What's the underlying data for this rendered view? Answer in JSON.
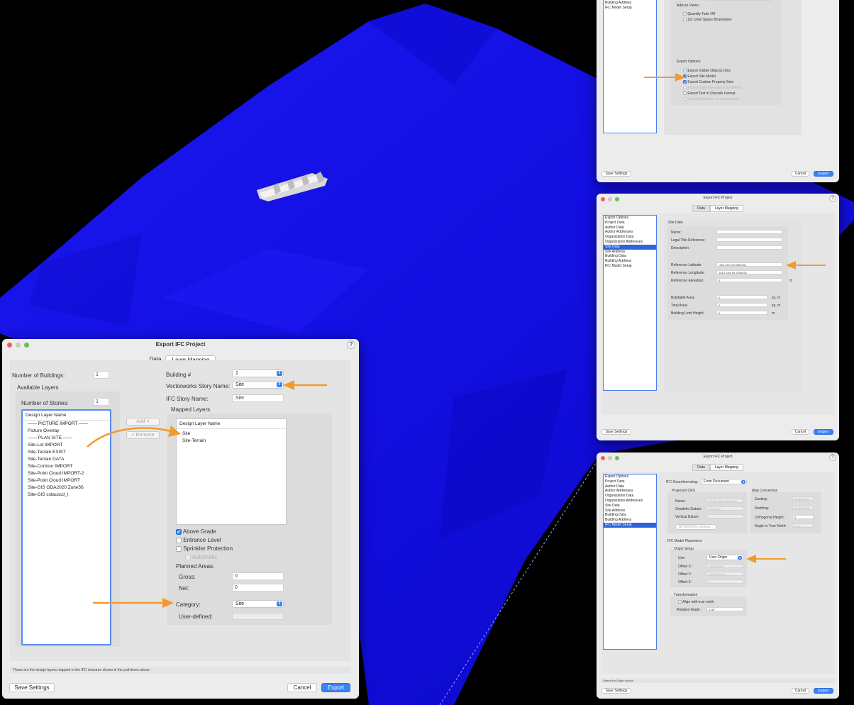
{
  "colors": {
    "terrain": "#1410e8",
    "accent": "#3a82f7",
    "arrow": "#f29a2e",
    "selection": "#2f64d9"
  },
  "main": {
    "title": "Export IFC Project",
    "tabs": [
      "Data",
      "Layer Mapping"
    ],
    "num_buildings_label": "Number of Buildings:",
    "num_buildings": "1",
    "available_layers_label": "Available Layers",
    "num_stories_label": "Number of Stories:",
    "num_stories": "1",
    "available_header": "Design Layer Name",
    "available": [
      "—— PICTURE IMPORT ——",
      "Picture Overlay",
      "—— PLAN SITE ——",
      "Site-Lot IMPORT",
      "Site-Terrain EXIST",
      "Site-Terrain DATA",
      "Site-Contour IMPORT",
      "Site-Point Cloud IMPORT-2",
      "Site-Point Cloud IMPORT",
      "Site-GIS GDA2020 Zone56",
      "Site-GIS cstauscd_l"
    ],
    "add_button": "Add >",
    "remove_button": "< Remove",
    "building_label": "Building #",
    "building_value": "1",
    "vw_story_label": "Vectorworks Story Name:",
    "vw_story_value": "Site",
    "ifc_story_label": "IFC Story Name:",
    "ifc_story_value": "Site",
    "mapped_label": "Mapped Layers",
    "mapped_header": "Design Layer Name",
    "mapped": [
      "Site",
      "Site-Terrain"
    ],
    "above_grade": "Above Grade",
    "entrance_level": "Entrance Level",
    "sprinkler": "Sprinkler Protection",
    "automatic": "Automatic",
    "planned_areas": "Planned Areas:",
    "gross_label": "Gross:",
    "gross_value": "0",
    "net_label": "Net:",
    "net_value": "0",
    "category_label": "Category:",
    "category_value": "Site",
    "user_defined_label": "User-defined:",
    "status": "These are the design layers mapped to the IFC structure shown in the pull-down above.",
    "save_settings": "Save Settings",
    "cancel": "Cancel",
    "export": "Export"
  },
  "top": {
    "sidebar": [
      "Building Address",
      "IFC Model Setup"
    ],
    "addon_label": "Add-on Views:",
    "addon": [
      "Quantity Take Off",
      "1st Level Space Boundaries"
    ],
    "options_label": "Export Options:",
    "options": [
      {
        "label": "Export Visible Objects Only",
        "checked": false,
        "enabled": true
      },
      {
        "label": "Export Site Model",
        "checked": true,
        "enabled": true
      },
      {
        "label": "Export Custom Property Sets",
        "checked": true,
        "enabled": true
      },
      {
        "label": "Export Solid Operations as BREPs",
        "checked": false,
        "enabled": false
      },
      {
        "label": "Export Text in Unicode Format",
        "checked": false,
        "enabled": true
      },
      {
        "label": "Export Metaltitles to components",
        "checked": false,
        "enabled": false
      }
    ],
    "save_settings": "Save Settings",
    "cancel": "Cancel",
    "export": "Export"
  },
  "mid": {
    "title": "Export IFC Project",
    "tabs": [
      "Data",
      "Layer Mapping"
    ],
    "sidebar": [
      "Export Options",
      "Project Data",
      "Author Data",
      "Author Addresses",
      "Organization Data",
      "Organization Addresses",
      "Site Data",
      "Site Address",
      "Building Data",
      "Building Address",
      "IFC Model Setup"
    ],
    "selected": "Site Data",
    "heading": "Site Data",
    "name": "Name:",
    "legal": "Legal Title Reference:",
    "description": "Description:",
    "ref_lat": "Reference Latitude:",
    "ref_lat_value": "-33d 48m 20.658076s",
    "ref_long": "Reference Longitude:",
    "ref_long_value": "151d 14m 59.425440s",
    "ref_elev": "Reference Elevation:",
    "ref_elev_value": "0",
    "unit_m": "m",
    "buildable": "Buildable Area:",
    "buildable_value": "0",
    "unit_sqm": "sq. m",
    "total": "Total Area:",
    "total_value": "0",
    "limit": "Building Limit Height:",
    "limit_value": "0",
    "save_settings": "Save Settings",
    "cancel": "Cancel",
    "export": "Export"
  },
  "bot": {
    "title": "Export IFC Project",
    "tabs": [
      "Data",
      "Layer Mapping"
    ],
    "sidebar": [
      "Export Options",
      "Project Data",
      "Author Data",
      "Author Addresses",
      "Organization Data",
      "Organization Addresses",
      "Site Data",
      "Site Address",
      "Building Data",
      "Building Address",
      "IFC Model Setup"
    ],
    "selected": "IFC Model Setup",
    "georef_label": "IFC Georeferencing:",
    "georef_value": "From Document",
    "projected_crs": "Projected CRS",
    "crs_name": "Name:",
    "crs_name_value": "EPSG:7856 GDA2020",
    "geodetic": "Geodetic Datum:",
    "geodetic_value": "GDA2020",
    "vertical": "Vertical Datum:",
    "lookup": "EPSG/CRS Lookup...",
    "map_conversion": "Map Conversion",
    "easting": "Easting:",
    "easting_value": "336620000",
    "northing": "Northing:",
    "northing_value": "6252930000",
    "ortho": "Orthogonal Height:",
    "ortho_value": "0",
    "angle_true_north": "Angle to True North:",
    "angle_true_north_value": "0.00°",
    "placement": "IFC Model Placement",
    "origin_setup": "Origin Setup",
    "use": "Use:",
    "use_value": "User Origin",
    "offset_x": "Offset X:",
    "offset_x_value": "-336620000",
    "offset_y": "Offset Y:",
    "offset_y_value": "-6252930000",
    "offset_z": "Offset Z:",
    "offset_z_value": "0",
    "transformation": "Transformation",
    "align_true_north": "Align with true north",
    "rotation": "Rotation Angle:",
    "rotation_value": "0.00°",
    "status": "Select the Origin source.",
    "save_settings": "Save Settings",
    "cancel": "Cancel",
    "export": "Export"
  }
}
